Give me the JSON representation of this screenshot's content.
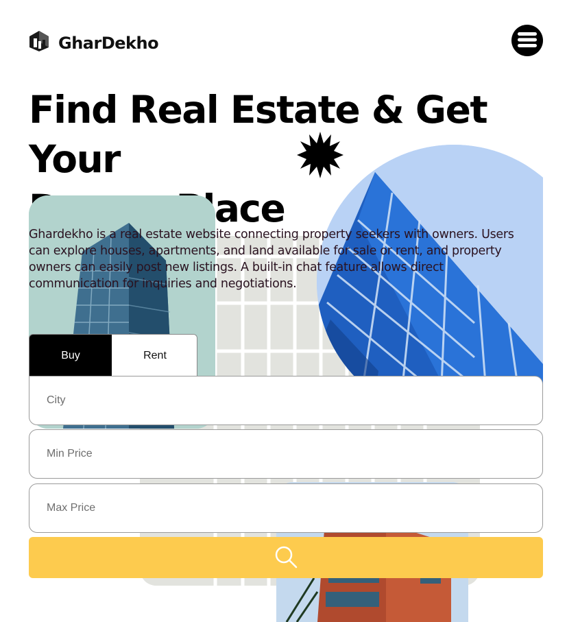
{
  "header": {
    "brand": "GharDekho",
    "logo_icon": "house-logo-icon",
    "menu_icon": "hamburger-menu-icon"
  },
  "hero": {
    "title_line1": "Find Real Estate & Get Your",
    "title_line2": "Dream Place",
    "decoration_icon": "starburst-icon",
    "description": "Ghardekho is a real estate website connecting property seekers with owners. Users can explore houses, apartments, and land available for sale or rent, and property owners can easily post new listings. A built-in chat feature allows direct communication for inquiries and negotiations."
  },
  "search": {
    "tabs": [
      {
        "label": "Buy",
        "active": true
      },
      {
        "label": "Rent",
        "active": false
      }
    ],
    "city_placeholder": "City",
    "min_price_placeholder": "Min Price",
    "max_price_placeholder": "Max Price",
    "submit_icon": "search-icon"
  },
  "colors": {
    "accent": "#fdcb4e",
    "primary": "#000000",
    "text": "#2a1220",
    "border": "#9a9a9a"
  }
}
